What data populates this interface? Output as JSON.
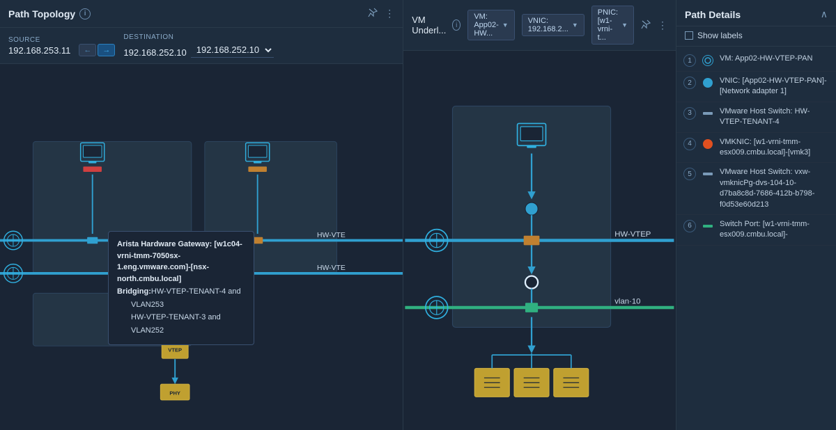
{
  "left_panel": {
    "title": "Path Topology",
    "info_icon": "i",
    "source_label": "Source",
    "source_value": "192.168.253.11",
    "destination_label": "Destination",
    "destination_value": "192.168.252.10",
    "direction_left": "←",
    "direction_right": "→",
    "pin_icon": "📌",
    "more_icon": "⋮",
    "tooltip": {
      "title": "Arista Hardware Gateway: [w1c04-vrni-tmm-7050sx-1.eng.vmware.com]-[nsx-north.cmbu.local]",
      "bridging_label": "Bridging:",
      "bridge1": "HW-VTEP-TENANT-4 and VLAN253",
      "bridge2": "HW-VTEP-TENANT-3 and VLAN252"
    },
    "hw_vtep_labels": [
      "HW-VTE",
      "HW-VTE"
    ]
  },
  "right_panel": {
    "title": "VM Underl...",
    "info_icon": "i",
    "vm_dropdown": "VM: App02-HW...",
    "vnic_dropdown": "VNIC: 192.168.2...",
    "pnic_dropdown": "PNIC: [w1-vrni-t...",
    "pin_icon": "📌",
    "more_icon": "⋮",
    "hw_vtep_label": "HW-VTEP",
    "vlan_label": "vlan·10"
  },
  "path_details": {
    "title": "Path Details",
    "show_labels": "Show labels",
    "collapse_icon": "∧",
    "items": [
      {
        "num": "1",
        "icon_type": "vm-ring",
        "text": "VM: App02-HW-VTEP-PAN"
      },
      {
        "num": "2",
        "icon_type": "vnic-solid",
        "text": "VNIC: [App02-HW-VTEP-PAN]-[Network adapter 1]"
      },
      {
        "num": "3",
        "icon_type": "dash",
        "text": "VMware Host Switch: HW-VTEP-TENANT-4"
      },
      {
        "num": "4",
        "icon_type": "vmknic-solid",
        "text": "VMKNIC: [w1-vrni-tmm-esx009.cmbu.local]-[vmk3]"
      },
      {
        "num": "5",
        "icon_type": "dash",
        "text": "VMware Host Switch: vxw-vmknicPg-dvs-104-10-d7ba8c8d-7686-412b-b798-f0d53e60d213"
      },
      {
        "num": "6",
        "icon_type": "dash-green",
        "text": "Switch Port: [w1-vrni-tmm-esx009.cmbu.local]-"
      }
    ]
  }
}
